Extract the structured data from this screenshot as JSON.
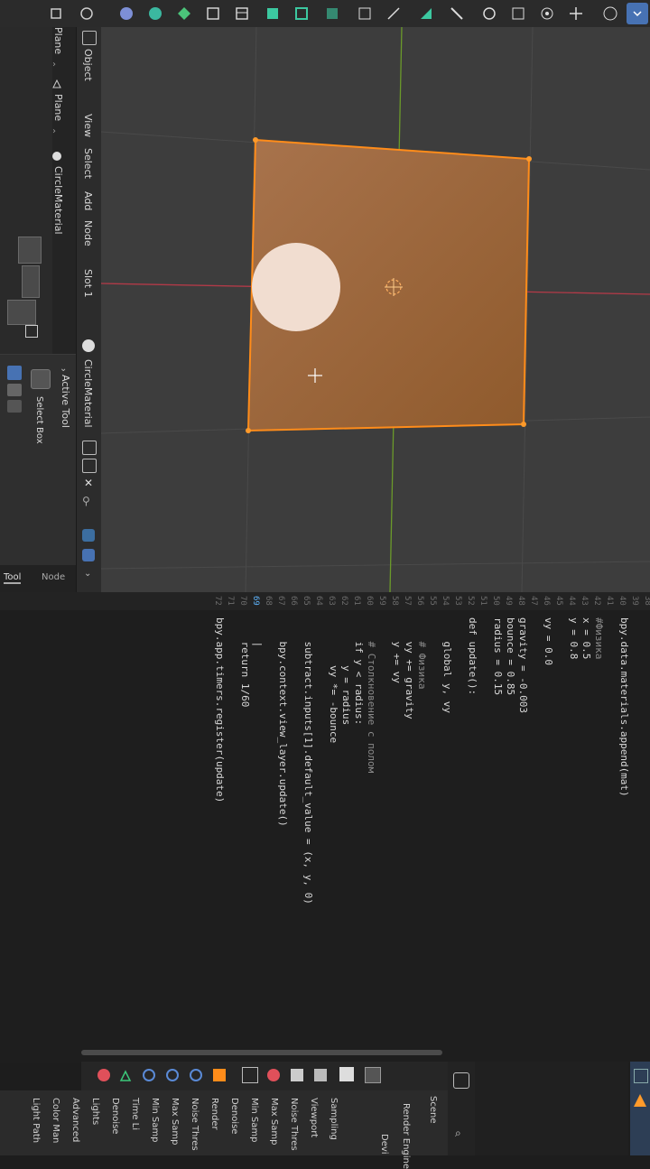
{
  "header": {
    "mode_labels": [
      "Object",
      "View",
      "Select",
      "Add",
      "Node"
    ],
    "slot": "Slot 1",
    "material": "CircleMaterial",
    "breadcrumb": [
      "Plane",
      "Plane",
      "CircleMaterial"
    ]
  },
  "active_tool": {
    "title": "Active Tool",
    "tool_name": "Select Box"
  },
  "side_tabs": [
    "Tool",
    "Node"
  ],
  "code": {
    "line_numbers": [
      "38",
      "39",
      "40",
      "41",
      "42",
      "43",
      "44",
      "45",
      "46",
      "47",
      "48",
      "49",
      "50",
      "51",
      "52",
      "53",
      "54",
      "55",
      "56",
      "57",
      "58",
      "59",
      "60",
      "61",
      "62",
      "63",
      "64",
      "65",
      "66",
      "67",
      "68",
      "69",
      "70",
      "71",
      "72"
    ],
    "lines": [
      {
        "text": "bpy.data.materials.append(mat)",
        "color": "#d8d8d8"
      },
      {
        "text": "",
        "color": "#d8d8d8"
      },
      {
        "text": "#Физика",
        "color": "#8a8a8a"
      },
      {
        "text": "x = 0.5",
        "color": "#d8d8d8"
      },
      {
        "text": "y = 0.8",
        "color": "#d8d8d8"
      },
      {
        "text": "",
        "color": "#d8d8d8"
      },
      {
        "text": "vy = 0.0",
        "color": "#d8d8d8"
      },
      {
        "text": "",
        "color": "#d8d8d8"
      },
      {
        "text": "gravity = -0.003",
        "color": "#d8d8d8"
      },
      {
        "text": "bounce = 0.85",
        "color": "#d8d8d8"
      },
      {
        "text": "radius = 0.15",
        "color": "#d8d8d8"
      },
      {
        "text": "",
        "color": "#d8d8d8"
      },
      {
        "text": "def update():",
        "color": "#d8d8d8"
      },
      {
        "text": "",
        "color": "#d8d8d8"
      },
      {
        "text": "    global y, vy",
        "color": "#d8d8d8"
      },
      {
        "text": "",
        "color": "#d8d8d8"
      },
      {
        "text": "    # Физика",
        "color": "#8a8a8a"
      },
      {
        "text": "    vy += gravity",
        "color": "#d8d8d8"
      },
      {
        "text": "    y += vy",
        "color": "#d8d8d8"
      },
      {
        "text": "",
        "color": "#d8d8d8"
      },
      {
        "text": "    # Столкновение с полом",
        "color": "#8a8a8a"
      },
      {
        "text": "    if y < radius:",
        "color": "#d8d8d8"
      },
      {
        "text": "        y = radius",
        "color": "#d8d8d8"
      },
      {
        "text": "        vy *= -bounce",
        "color": "#d8d8d8"
      },
      {
        "text": "",
        "color": "#d8d8d8"
      },
      {
        "text": "    subtract.inputs[1].default_value = (x, y, 0)",
        "color": "#d8d8d8"
      },
      {
        "text": "",
        "color": "#d8d8d8"
      },
      {
        "text": "    bpy.context.view_layer.update()",
        "color": "#d8d8d8"
      },
      {
        "text": "",
        "color": "#d8d8d8"
      },
      {
        "text": "    |",
        "color": "#d8d8d8"
      },
      {
        "text": "    return 1/60",
        "color": "#d8d8d8"
      },
      {
        "text": "",
        "color": "#d8d8d8"
      },
      {
        "text": "bpy.app.timers.register(update)",
        "color": "#d8d8d8"
      }
    ],
    "current_line": "69"
  },
  "properties": {
    "items": [
      "Sampling",
      "Viewport",
      "Noise Thres",
      "Max Samp",
      "Min Samp",
      "Denoise",
      "Render",
      "Noise Thres",
      "Max Samp",
      "Min Samp",
      "Time Li",
      "Denoise",
      "Lights",
      "Advanced",
      "Color Man",
      "Light Path"
    ],
    "render_engine": "Render Engine",
    "device": "Devi",
    "scene": "Scene"
  },
  "colors": {
    "plane_edge": "#ff8c1a",
    "plane_fill": "#a0673a",
    "circle": "#f1ddd0",
    "x_axis": "#b23a48",
    "y_axis": "#6b9a2a"
  }
}
